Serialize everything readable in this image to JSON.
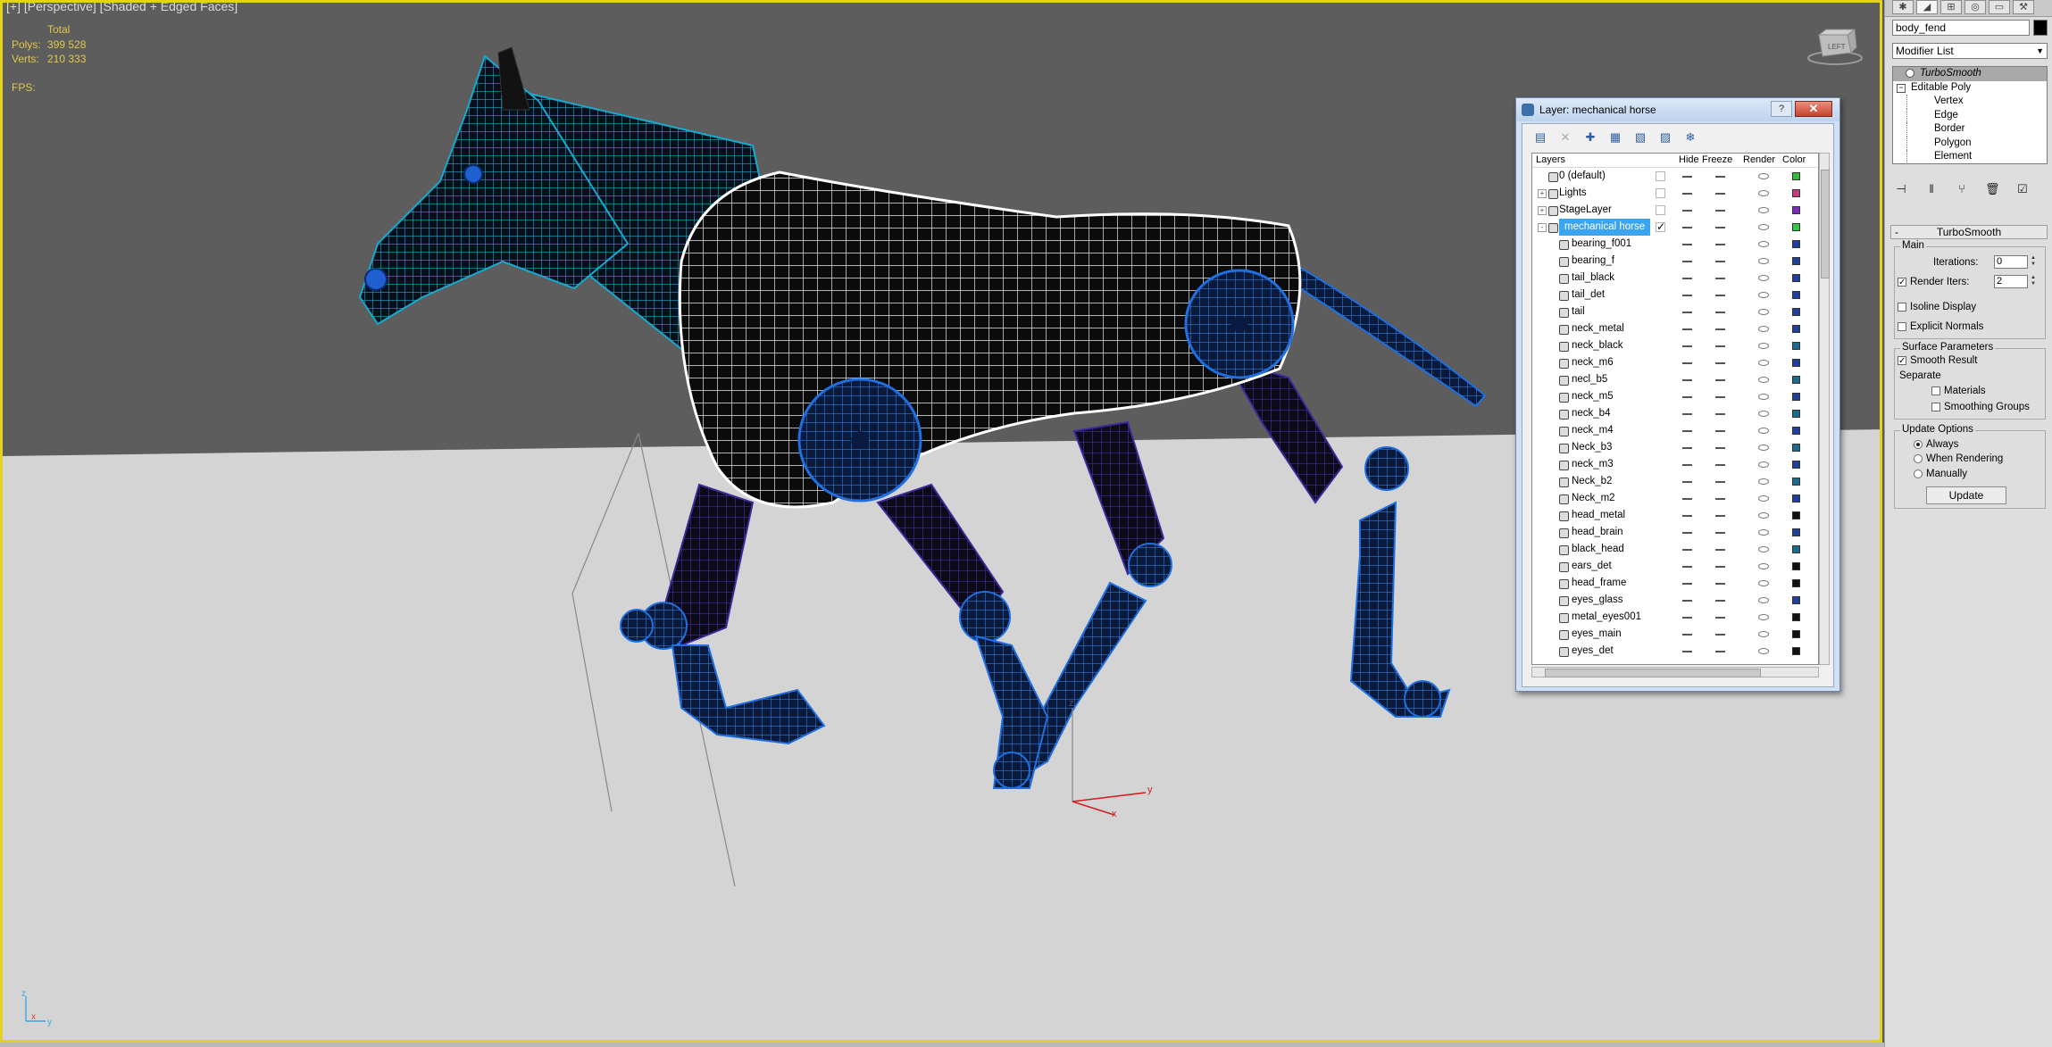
{
  "viewport": {
    "label": "[+] [Perspective] [Shaded + Edged Faces]",
    "stats": {
      "total_label": "Total",
      "polys_label": "Polys:",
      "polys_value": "399 528",
      "verts_label": "Verts:",
      "verts_value": "210 333",
      "fps_label": "FPS:"
    },
    "viewcube_label": "LEFT",
    "gizmo_labels": {
      "z": "z",
      "y": "y",
      "x": "x"
    },
    "corner_axis_labels": {
      "z": "z",
      "x": "x",
      "y": "y"
    }
  },
  "command_panel": {
    "tabs": [
      "create",
      "modify",
      "hierarchy",
      "motion",
      "display",
      "utilities"
    ],
    "object_name": "body_fend",
    "object_color": "#000000",
    "modifier_list_label": "Modifier List",
    "stack": {
      "top_modifier": "TurboSmooth",
      "base_object": "Editable Poly",
      "sub_objects": [
        "Vertex",
        "Edge",
        "Border",
        "Polygon",
        "Element"
      ]
    },
    "rollout_title": "TurboSmooth",
    "main_group": {
      "title": "Main",
      "iterations_label": "Iterations:",
      "iterations_value": "0",
      "render_iters_label": "Render Iters:",
      "render_iters_value": "2",
      "render_iters_checked": true,
      "isoline_label": "Isoline Display",
      "isoline_checked": false,
      "explicit_normals_label": "Explicit Normals",
      "explicit_normals_checked": false
    },
    "surface_group": {
      "title": "Surface Parameters",
      "smooth_result_label": "Smooth Result",
      "smooth_result_checked": true,
      "separate_label": "Separate",
      "materials_label": "Materials",
      "materials_checked": false,
      "smoothing_groups_label": "Smoothing Groups",
      "smoothing_groups_checked": false
    },
    "update_group": {
      "title": "Update Options",
      "options": [
        "Always",
        "When Rendering",
        "Manually"
      ],
      "selected": "Always",
      "update_button": "Update"
    }
  },
  "layer_window": {
    "title": "Layer: mechanical horse",
    "help_label": "?",
    "close_label": "✕",
    "toolbar_icons": [
      "new-layer-icon",
      "delete-layer-icon",
      "add-to-layer-icon",
      "select-in-layer-icon",
      "highlight-layer-icon",
      "hide-all-icon",
      "freeze-all-icon"
    ],
    "columns": {
      "layers": "Layers",
      "hide": "Hide",
      "freeze": "Freeze",
      "render": "Render",
      "color": "Color"
    },
    "rows": [
      {
        "name": "0 (default)",
        "level": 0,
        "expander": "",
        "current": false,
        "checkbox": true,
        "color": "#2fbd3c"
      },
      {
        "name": "Lights",
        "level": 0,
        "expander": "+",
        "current": false,
        "checkbox": true,
        "color": "#c83a78"
      },
      {
        "name": "StageLayer",
        "level": 0,
        "expander": "+",
        "current": false,
        "checkbox": true,
        "color": "#7a2cb8"
      },
      {
        "name": "mechanical horse",
        "level": 0,
        "expander": "-",
        "current": true,
        "checkbox": true,
        "color": "#38c645",
        "selected": true
      },
      {
        "name": "bearing_f001",
        "level": 1,
        "color": "#1f3f9a"
      },
      {
        "name": "bearing_f",
        "level": 1,
        "color": "#1f3f9a"
      },
      {
        "name": "tail_black",
        "level": 1,
        "color": "#1f3f9a"
      },
      {
        "name": "tail_det",
        "level": 1,
        "color": "#1f3f9a"
      },
      {
        "name": "tail",
        "level": 1,
        "color": "#1f3f9a"
      },
      {
        "name": "neck_metal",
        "level": 1,
        "color": "#1f3f9a"
      },
      {
        "name": "neck_black",
        "level": 1,
        "color": "#1f6a8c"
      },
      {
        "name": "neck_m6",
        "level": 1,
        "color": "#1f3f9a"
      },
      {
        "name": "necl_b5",
        "level": 1,
        "color": "#1f6a8c"
      },
      {
        "name": "neck_m5",
        "level": 1,
        "color": "#1f3f9a"
      },
      {
        "name": "neck_b4",
        "level": 1,
        "color": "#1f6a8c"
      },
      {
        "name": "neck_m4",
        "level": 1,
        "color": "#1f3f9a"
      },
      {
        "name": "Neck_b3",
        "level": 1,
        "color": "#1f6a8c"
      },
      {
        "name": "neck_m3",
        "level": 1,
        "color": "#1f3f9a"
      },
      {
        "name": "Neck_b2",
        "level": 1,
        "color": "#1f6a8c"
      },
      {
        "name": "Neck_m2",
        "level": 1,
        "color": "#1f3f9a"
      },
      {
        "name": "head_metal",
        "level": 1,
        "color": "#111111"
      },
      {
        "name": "head_brain",
        "level": 1,
        "color": "#1f3f9a"
      },
      {
        "name": "black_head",
        "level": 1,
        "color": "#1f6a8c"
      },
      {
        "name": "ears_det",
        "level": 1,
        "color": "#111111"
      },
      {
        "name": "head_frame",
        "level": 1,
        "color": "#111111"
      },
      {
        "name": "eyes_glass",
        "level": 1,
        "color": "#1f3f9a"
      },
      {
        "name": "metal_eyes001",
        "level": 1,
        "color": "#111111"
      },
      {
        "name": "eyes_main",
        "level": 1,
        "color": "#111111"
      },
      {
        "name": "eyes_det",
        "level": 1,
        "color": "#111111"
      }
    ]
  },
  "colors": {
    "viewport_border": "#e4d31a",
    "stats_text": "#e2c64c",
    "selection_blue": "#3aa4ef",
    "horse_blue": "#1c5bd6",
    "horse_cyan": "#1aa7c9"
  }
}
